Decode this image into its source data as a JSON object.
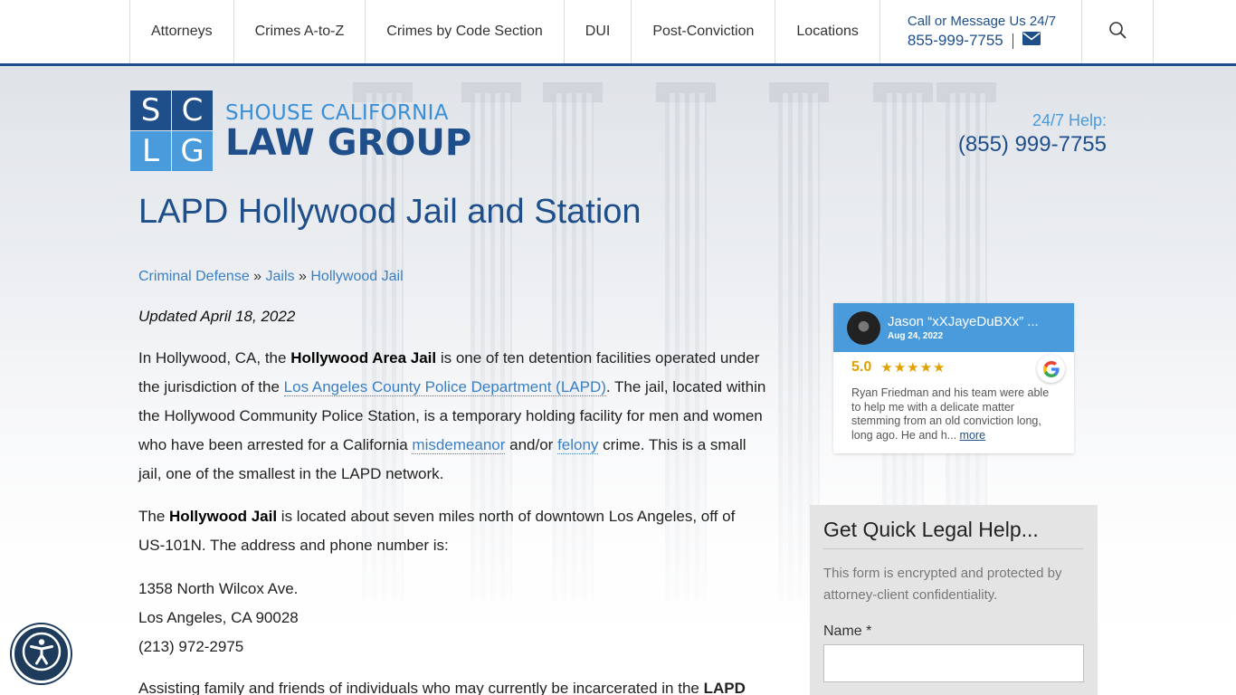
{
  "nav": {
    "items": [
      "Attorneys",
      "Crimes A-to-Z",
      "Crimes by Code Section",
      "DUI",
      "Post-Conviction",
      "Locations"
    ],
    "call_label": "Call or Message Us 24/7",
    "call_phone": "855-999-7755"
  },
  "logo": {
    "letters": [
      "S",
      "C",
      "L",
      "G"
    ],
    "top": "SHOUSE CALIFORNIA",
    "bottom": "LAW GROUP"
  },
  "help": {
    "label": "24/7 Help:",
    "phone": "(855) 999-7755"
  },
  "page": {
    "title": "LAPD Hollywood Jail and Station",
    "breadcrumbs": [
      "Criminal Defense",
      "Jails",
      "Hollywood Jail"
    ],
    "breadcrumb_sep": "»",
    "updated": "Updated April 18, 2022",
    "p1": {
      "t1": "In Hollywood, CA, the ",
      "b1": "Hollywood Area Jail",
      "t2": " is one of ten detention facilities operated under the jurisdiction of the ",
      "link1": "Los Angeles County Police Department (LAPD)",
      "t3": ". The jail, located within the Hollywood Community Police Station, is a temporary holding facility for men and women who have been arrested for a California ",
      "link2": "misdemeanor",
      "t4": " and/or ",
      "link3": "felony",
      "t5": " crime. This is a small jail, one of the smallest in the LAPD network."
    },
    "p2": {
      "t1": "The ",
      "b1": "Hollywood Jail",
      "t2": " is located about seven miles north of downtown Los Angeles, off of US-101N. The address and phone number is:"
    },
    "address": [
      "1358 North Wilcox Ave.",
      "Los Angeles, CA 90028",
      "(213) 972-2975"
    ],
    "p3": {
      "t1": "Assisting family and friends of individuals who may currently be incarcerated in the ",
      "b1": "LAPD"
    }
  },
  "review": {
    "name": "Jason “xXJayeDuBXx” ...",
    "date": "Aug 24, 2022",
    "score": "5.0",
    "stars": "★★★★★",
    "text": "Ryan Friedman and his team were able to help me with a delicate matter stemming from an old conviction long, long ago. He and h...",
    "more": "more"
  },
  "form": {
    "title": "Get Quick Legal Help...",
    "note": "This form is encrypted and protected by attorney-client confidentiality.",
    "name_label": "Name *"
  },
  "colors": {
    "brand_dark": "#1f4f8a",
    "brand_light": "#4a9bdc",
    "star": "#e1a100"
  }
}
